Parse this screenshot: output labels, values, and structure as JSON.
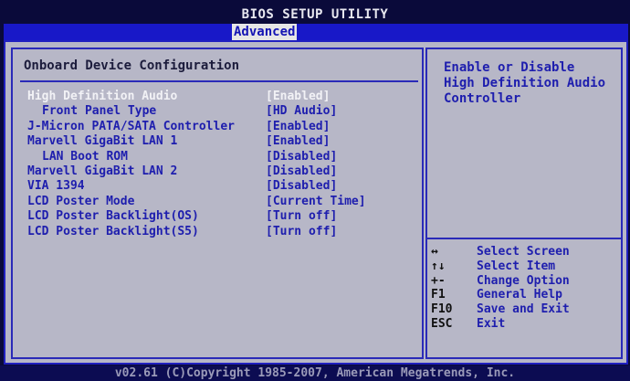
{
  "title": "BIOS SETUP UTILITY",
  "tabs": [
    {
      "label": "Advanced",
      "active": true
    }
  ],
  "section_title": "Onboard Device Configuration",
  "settings": [
    {
      "label": "High Definition Audio",
      "value": "[Enabled]",
      "indent": false,
      "selected": true
    },
    {
      "label": "Front Panel Type",
      "value": "[HD Audio]",
      "indent": true,
      "selected": false
    },
    {
      "label": "J-Micron PATA/SATA Controller",
      "value": "[Enabled]",
      "indent": false,
      "selected": false
    },
    {
      "label": "Marvell GigaBit LAN 1",
      "value": "[Enabled]",
      "indent": false,
      "selected": false
    },
    {
      "label": "LAN Boot ROM",
      "value": "[Disabled]",
      "indent": true,
      "selected": false
    },
    {
      "label": "Marvell GigaBit LAN 2",
      "value": "[Disabled]",
      "indent": false,
      "selected": false
    },
    {
      "label": "VIA 1394",
      "value": "[Disabled]",
      "indent": false,
      "selected": false
    },
    {
      "label": "LCD Poster Mode",
      "value": "[Current Time]",
      "indent": false,
      "selected": false
    },
    {
      "label": "LCD Poster Backlight(OS)",
      "value": "[Turn off]",
      "indent": false,
      "selected": false
    },
    {
      "label": "LCD Poster Backlight(S5)",
      "value": "[Turn off]",
      "indent": false,
      "selected": false
    }
  ],
  "help": {
    "lines": [
      "Enable or Disable",
      "High Definition Audio",
      "Controller"
    ]
  },
  "keys": [
    {
      "key": "↔",
      "desc": "Select Screen"
    },
    {
      "key": "↑↓",
      "desc": "Select Item"
    },
    {
      "key": "+-",
      "desc": "Change Option"
    },
    {
      "key": "F1",
      "desc": "General Help"
    },
    {
      "key": "F10",
      "desc": "Save and Exit"
    },
    {
      "key": "ESC",
      "desc": "Exit"
    }
  ],
  "footer": "v02.61 (C)Copyright 1985-2007, American Megatrends, Inc.",
  "colors": {
    "background": "#0a0a3a",
    "tab_strip": "#1818c8",
    "panel": "#b7b7c7",
    "item_text": "#1e1eae",
    "selected_text": "#f2f2f6"
  }
}
